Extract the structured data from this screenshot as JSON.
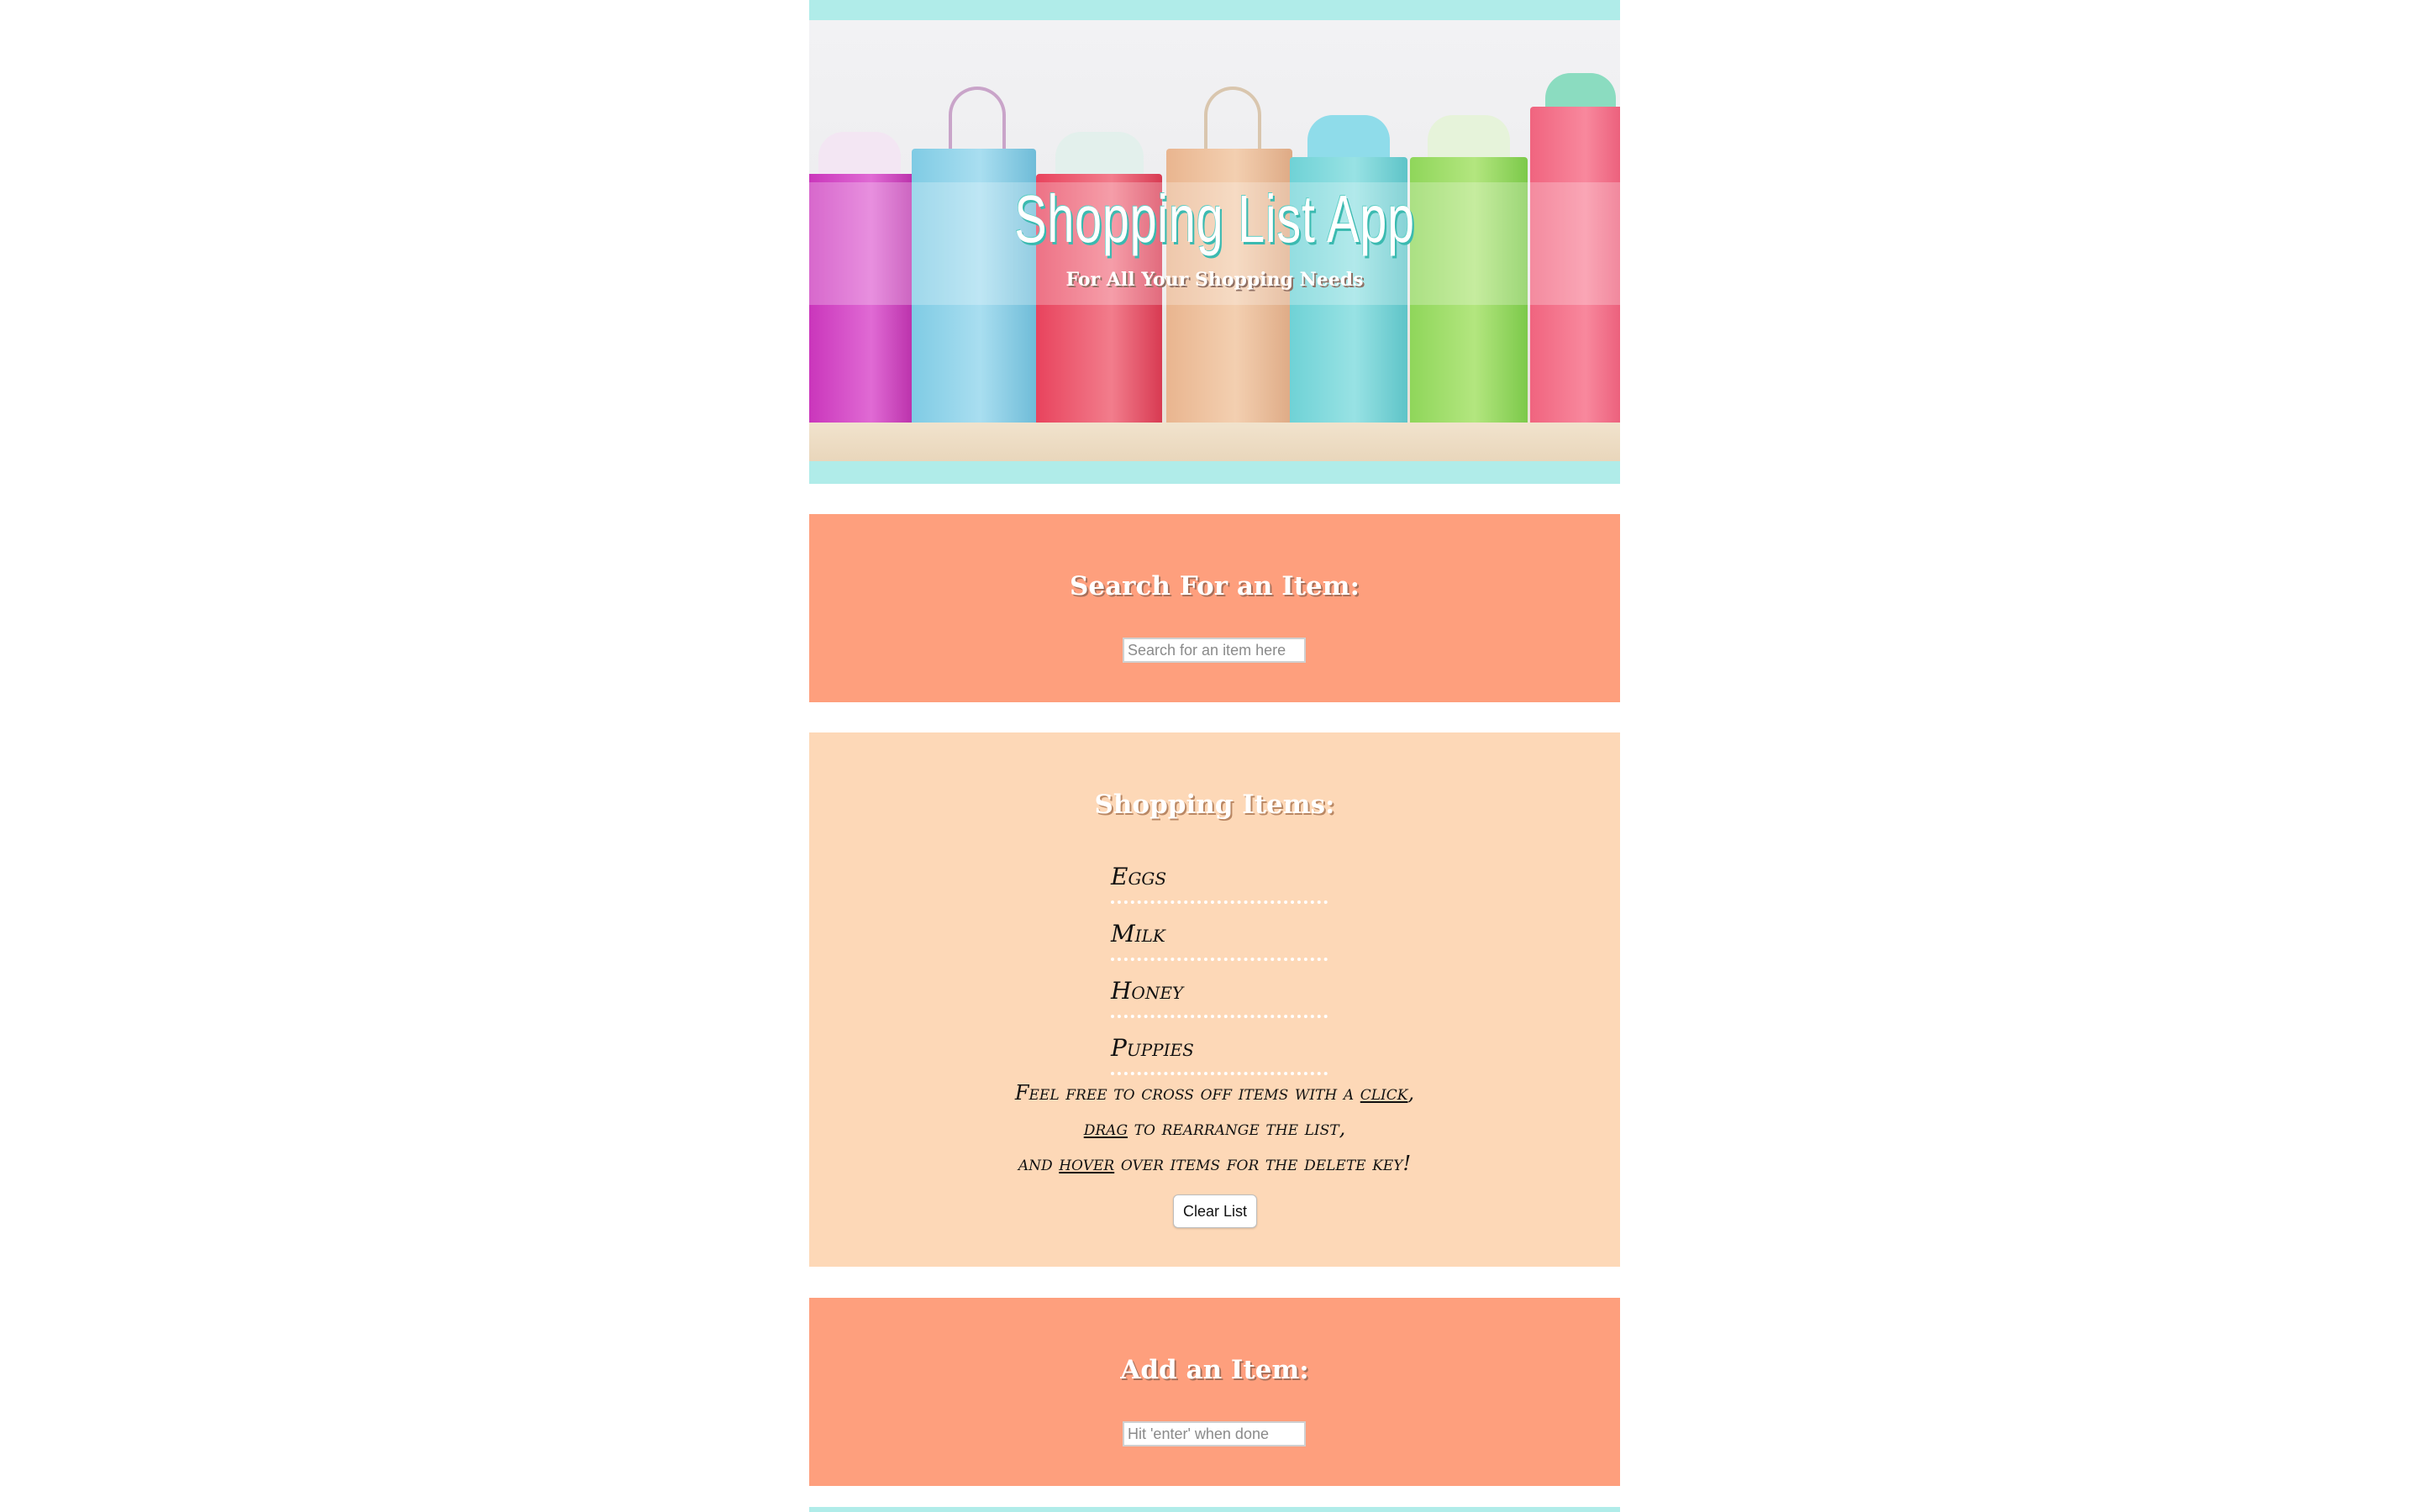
{
  "header": {
    "title": "Shopping List App",
    "subtitle": "For All Your Shopping Needs"
  },
  "search": {
    "heading": "Search For an Item:",
    "placeholder": "Search for an item here"
  },
  "items": {
    "heading": "Shopping Items:",
    "list": [
      "Eggs",
      "Milk",
      "Honey",
      "Puppies"
    ],
    "instructions": {
      "line1_pre": "Feel free to cross off items with a ",
      "line1_link": "click",
      "line1_post": ",",
      "line2_link": "drag",
      "line2_post": " to rearrange the list,",
      "line3_pre": "and ",
      "line3_link": "hover",
      "line3_post": " over items for the delete key!"
    },
    "clear_label": "Clear List"
  },
  "add": {
    "heading": "Add an Item:",
    "placeholder": "Hit 'enter' when done"
  },
  "colors": {
    "header_band": "#b0ece9",
    "panel_coral": "#fe9f7d",
    "panel_peach": "#fdd8b7"
  }
}
